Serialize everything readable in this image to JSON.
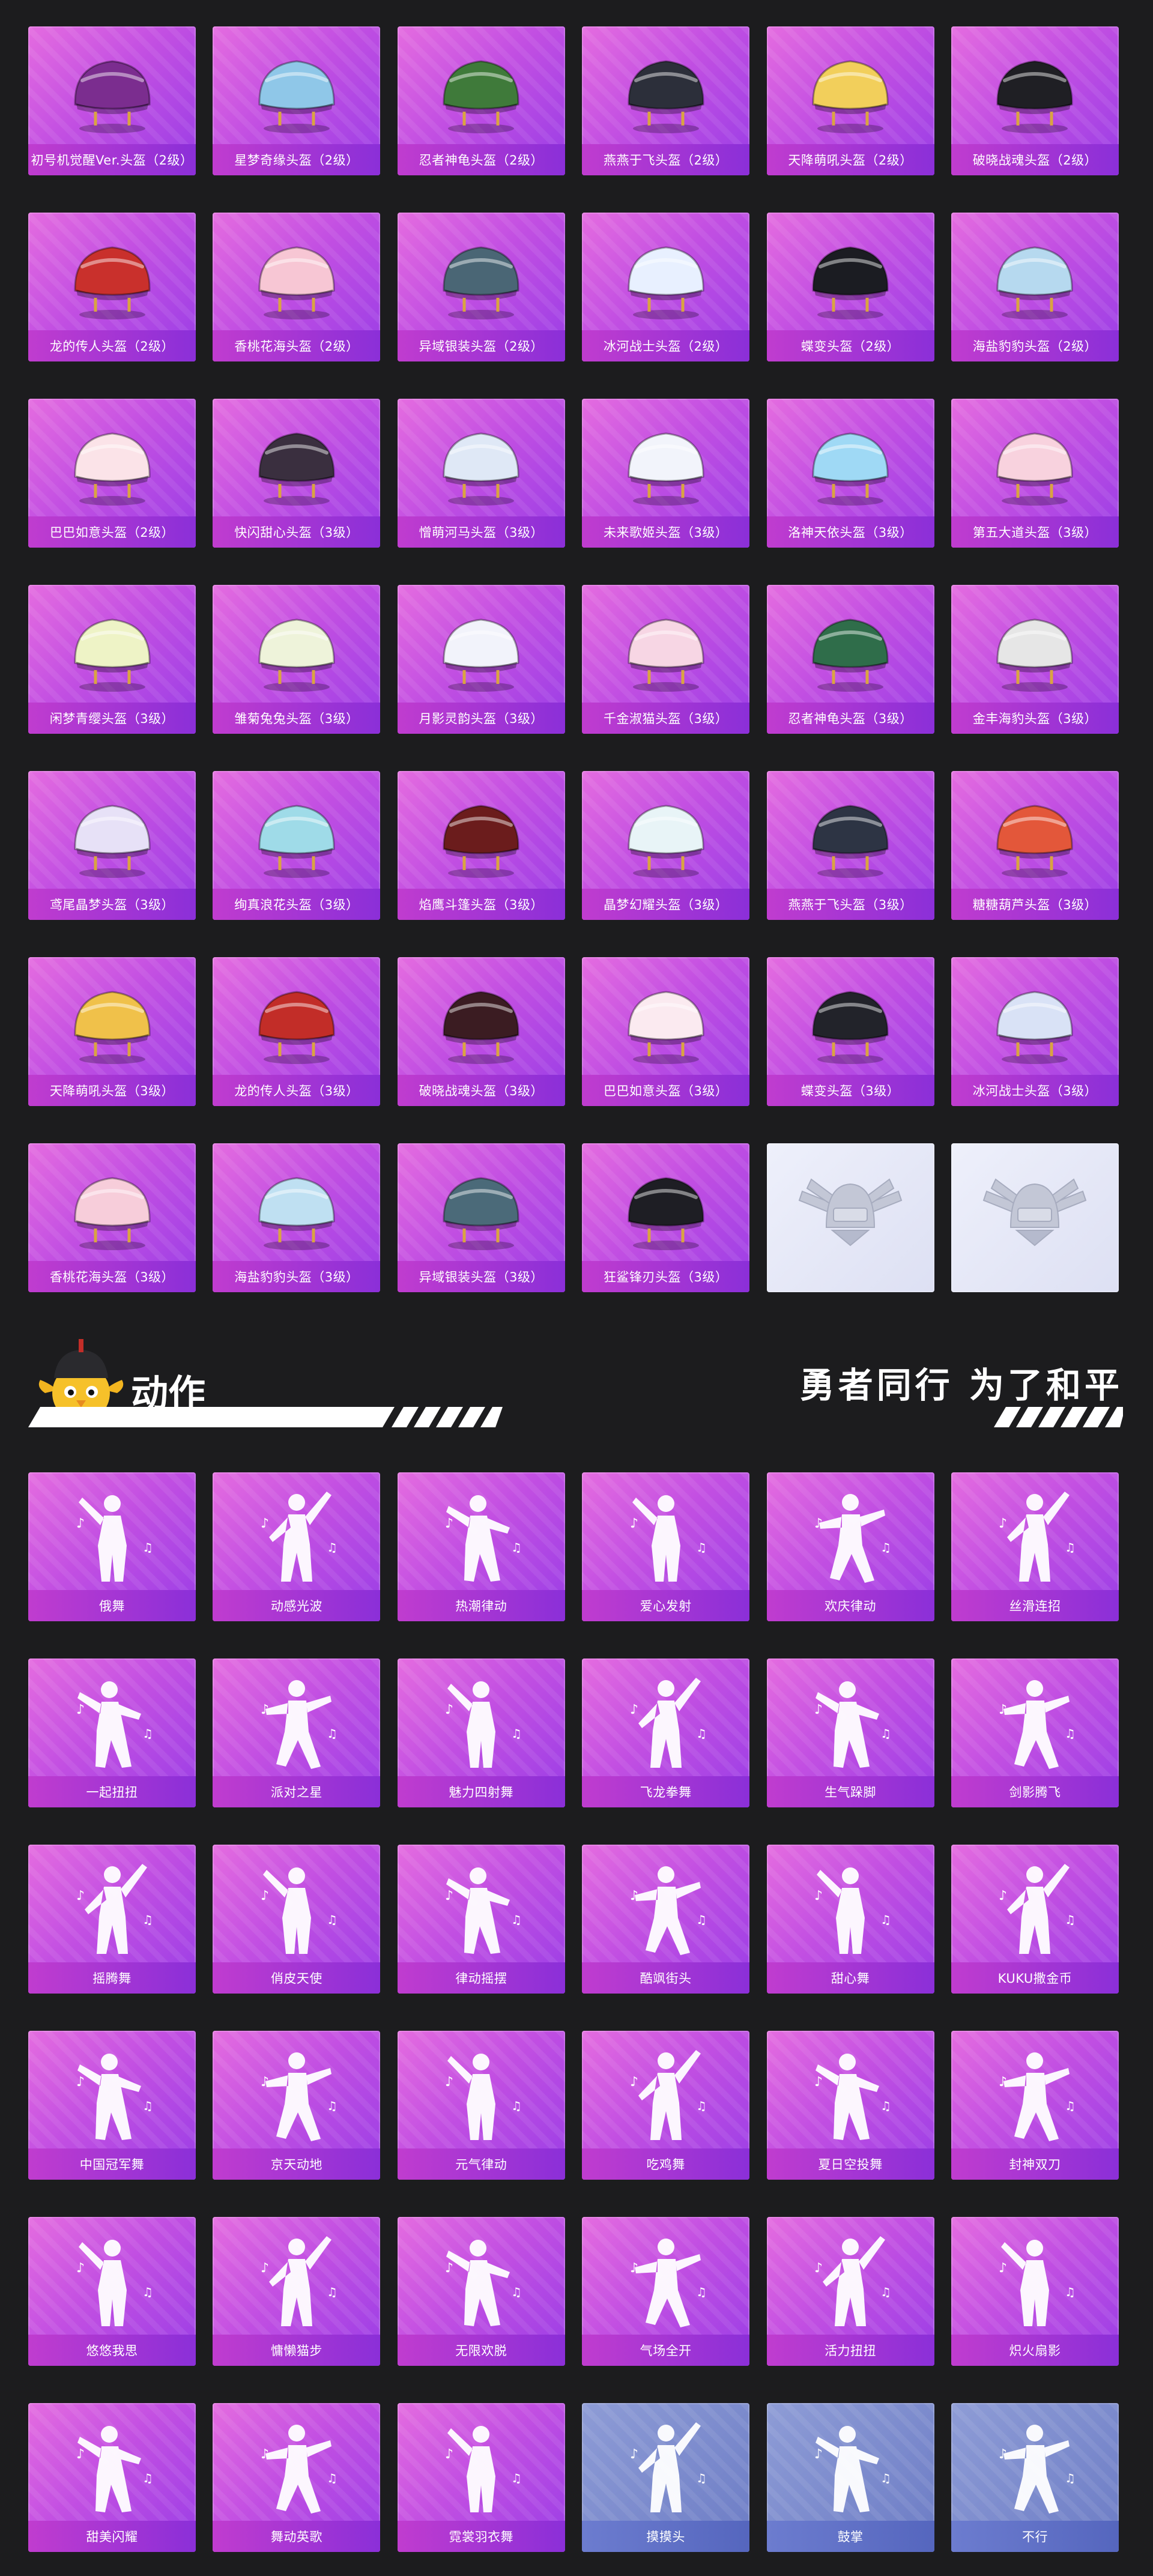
{
  "helmets": [
    {
      "label": "初号机觉醒Ver.头盔（2级）",
      "color": "#7b2d8f"
    },
    {
      "label": "星梦奇缘头盔（2级）",
      "color": "#8fc7e8"
    },
    {
      "label": "忍者神龟头盔（2级）",
      "color": "#3f7a3a"
    },
    {
      "label": "燕燕于飞头盔（2级）",
      "color": "#2c2f3a"
    },
    {
      "label": "天降萌吼头盔（2级）",
      "color": "#f2cf5b"
    },
    {
      "label": "破晓战魂头盔（2级）",
      "color": "#1f1f24"
    },
    {
      "label": "龙的传人头盔（2级）",
      "color": "#c9302c"
    },
    {
      "label": "香桃花海头盔（2级）",
      "color": "#f7c6d4"
    },
    {
      "label": "异域银装头盔（2级）",
      "color": "#4a6675"
    },
    {
      "label": "冰河战士头盔（2级）",
      "color": "#e8f0ff"
    },
    {
      "label": "蝶变头盔（2级）",
      "color": "#1b1c22"
    },
    {
      "label": "海盐豹豹头盔（2级）",
      "color": "#b6d9ef"
    },
    {
      "label": "巴巴如意头盔（2级）",
      "color": "#fbe3e8"
    },
    {
      "label": "快闪甜心头盔（3级）",
      "color": "#3a2f3f"
    },
    {
      "label": "憎萌河马头盔（3级）",
      "color": "#dfe8f6"
    },
    {
      "label": "未来歌姬头盔（3级）",
      "color": "#f2f4fb"
    },
    {
      "label": "洛神天依头盔（3级）",
      "color": "#9fd9f5"
    },
    {
      "label": "第五大道头盔（3级）",
      "color": "#f8d2de"
    },
    {
      "label": "闲梦青缨头盔（3级）",
      "color": "#eef3c6"
    },
    {
      "label": "雏菊兔兔头盔（3级）",
      "color": "#eef3da"
    },
    {
      "label": "月影灵韵头盔（3级）",
      "color": "#f2f3fb"
    },
    {
      "label": "千金淑猫头盔（3级）",
      "color": "#f7d6e4"
    },
    {
      "label": "忍者神龟头盔（3级）",
      "color": "#2f6d4a"
    },
    {
      "label": "金丰海豹头盔（3级）",
      "color": "#e6e6e6"
    },
    {
      "label": "鸢尾晶梦头盔（3级）",
      "color": "#e7e1f7"
    },
    {
      "label": "绚真浪花头盔（3级）",
      "color": "#9fdbe8"
    },
    {
      "label": "焰鹰斗篷头盔（3级）",
      "color": "#6b1c1c"
    },
    {
      "label": "晶梦幻耀头盔（3级）",
      "color": "#e8f4f7"
    },
    {
      "label": "燕燕于飞头盔（3级）",
      "color": "#2d3444"
    },
    {
      "label": "糖糖葫芦头盔（3级）",
      "color": "#e3573a"
    },
    {
      "label": "天降萌吼头盔（3级）",
      "color": "#f0c14a"
    },
    {
      "label": "龙的传人头盔（3级）",
      "color": "#c22d28"
    },
    {
      "label": "破晓战魂头盔（3级）",
      "color": "#3b1c22"
    },
    {
      "label": "巴巴如意头盔（3级）",
      "color": "#fbeaf0"
    },
    {
      "label": "蝶变头盔（3级）",
      "color": "#22232a"
    },
    {
      "label": "冰河战士头盔（3级）",
      "color": "#d9e2f6"
    },
    {
      "label": "香桃花海头盔（3级）",
      "color": "#f7cdda"
    },
    {
      "label": "海盐豹豹头盔（3级）",
      "color": "#bfe0f2"
    },
    {
      "label": "异域银装头盔（3级）",
      "color": "#4b6a79"
    },
    {
      "label": "狂鲨锋刃头盔（3级）",
      "color": "#1e1e24"
    },
    {
      "label": "",
      "color": "#c9ccd9",
      "silver": true
    },
    {
      "label": "",
      "color": "#c9ccd9",
      "silver": true
    }
  ],
  "section": {
    "title": "动作",
    "slogan": "勇者同行 为了和平"
  },
  "emotes": [
    {
      "label": "俄舞",
      "pose": 1
    },
    {
      "label": "动感光波",
      "pose": 2
    },
    {
      "label": "热潮律动",
      "pose": 3
    },
    {
      "label": "爱心发射",
      "pose": 1
    },
    {
      "label": "欢庆律动",
      "pose": 4
    },
    {
      "label": "丝滑连招",
      "pose": 2
    },
    {
      "label": "一起扭扭",
      "pose": 3
    },
    {
      "label": "派对之星",
      "pose": 4
    },
    {
      "label": "魅力四射舞",
      "pose": 1
    },
    {
      "label": "飞龙拳舞",
      "pose": 2
    },
    {
      "label": "生气跺脚",
      "pose": 3
    },
    {
      "label": "剑影腾飞",
      "pose": 4
    },
    {
      "label": "摇腾舞",
      "pose": 2
    },
    {
      "label": "俏皮天使",
      "pose": 1
    },
    {
      "label": "律动摇摆",
      "pose": 3
    },
    {
      "label": "酷飒街头",
      "pose": 4
    },
    {
      "label": "甜心舞",
      "pose": 1
    },
    {
      "label": "KUKU撒金币",
      "pose": 2
    },
    {
      "label": "中国冠军舞",
      "pose": 3
    },
    {
      "label": "京天动地",
      "pose": 4
    },
    {
      "label": "元气律动",
      "pose": 1
    },
    {
      "label": "吃鸡舞",
      "pose": 2
    },
    {
      "label": "夏日空投舞",
      "pose": 3
    },
    {
      "label": "封神双刀",
      "pose": 4
    },
    {
      "label": "悠悠我思",
      "pose": 1
    },
    {
      "label": "慵懒猫步",
      "pose": 2
    },
    {
      "label": "无限欢脱",
      "pose": 3
    },
    {
      "label": "气场全开",
      "pose": 4
    },
    {
      "label": "活力扭扭",
      "pose": 2
    },
    {
      "label": "炽火扇影",
      "pose": 1
    },
    {
      "label": "甜美闪耀",
      "pose": 3
    },
    {
      "label": "舞动英歌",
      "pose": 4
    },
    {
      "label": "霓裳羽衣舞",
      "pose": 1
    },
    {
      "label": "摸摸头",
      "pose": 2,
      "gray": true
    },
    {
      "label": "鼓掌",
      "pose": 3,
      "gray": true
    },
    {
      "label": "不行",
      "pose": 4,
      "gray": true
    }
  ]
}
